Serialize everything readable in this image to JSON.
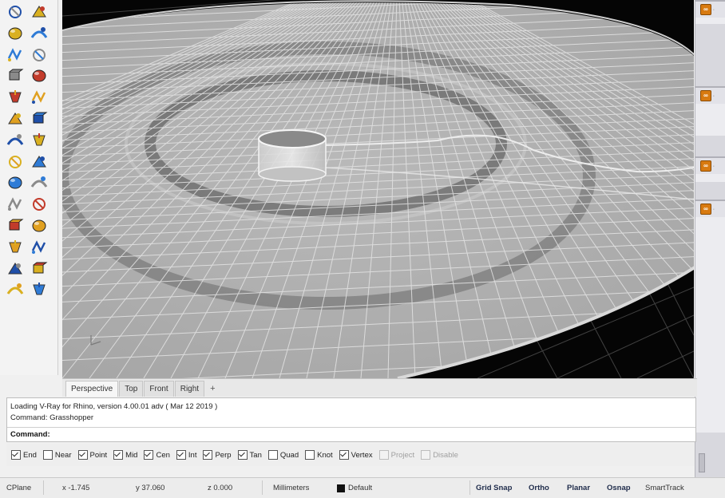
{
  "toolbar": {
    "tools": [
      [
        "circle-tool",
        "polygon-tool"
      ],
      [
        "transform-tool",
        "dimension-tool"
      ],
      [
        "solid-box-tool",
        "solid-sphere-tool"
      ],
      [
        "surface-tool",
        "surface-edit-tool"
      ],
      [
        "light-tool",
        "explode-tool"
      ],
      [
        "analyze-tool",
        "join-tool"
      ],
      [
        "point-edit-tool",
        "control-point-tool"
      ],
      [
        "curve-tool",
        "fillet-tool"
      ],
      [
        "move-tool",
        "scale-tool"
      ],
      [
        "group-tool",
        "block-tool"
      ],
      [
        "render-tool",
        "dimension-line-tool"
      ],
      [
        "array-tool",
        "layer-tool"
      ],
      [
        "properties-tool",
        "check-tool"
      ],
      [
        "paint-tool",
        "material-tool"
      ]
    ]
  },
  "viewport_tabs": {
    "tabs": [
      "Perspective",
      "Top",
      "Front",
      "Right"
    ],
    "active": "Perspective",
    "add_label": "+"
  },
  "command": {
    "history": [
      "Loading V-Ray for Rhino, version 4.00.01 adv ( Mar 12 2019 )",
      "Command: Grasshopper"
    ],
    "prompt": "Command:"
  },
  "osnap": [
    {
      "label": "End",
      "checked": true,
      "enabled": true
    },
    {
      "label": "Near",
      "checked": false,
      "enabled": true
    },
    {
      "label": "Point",
      "checked": true,
      "enabled": true
    },
    {
      "label": "Mid",
      "checked": true,
      "enabled": true
    },
    {
      "label": "Cen",
      "checked": true,
      "enabled": true
    },
    {
      "label": "Int",
      "checked": true,
      "enabled": true
    },
    {
      "label": "Perp",
      "checked": true,
      "enabled": true
    },
    {
      "label": "Tan",
      "checked": true,
      "enabled": true
    },
    {
      "label": "Quad",
      "checked": false,
      "enabled": true
    },
    {
      "label": "Knot",
      "checked": false,
      "enabled": true
    },
    {
      "label": "Vertex",
      "checked": true,
      "enabled": true
    },
    {
      "label": "Project",
      "checked": false,
      "enabled": false
    },
    {
      "label": "Disable",
      "checked": false,
      "enabled": false
    }
  ],
  "status": {
    "cplane": "CPlane",
    "x": "x -1.745",
    "y": "y 37.060",
    "z": "z 0.000",
    "units": "Millimeters",
    "layer": "Default",
    "layer_color": "#111111",
    "toggles": [
      "Grid Snap",
      "Ortho",
      "Planar",
      "Osnap",
      "SmartTrack"
    ]
  },
  "right_panel": {
    "icon_color": "#d87a10"
  }
}
